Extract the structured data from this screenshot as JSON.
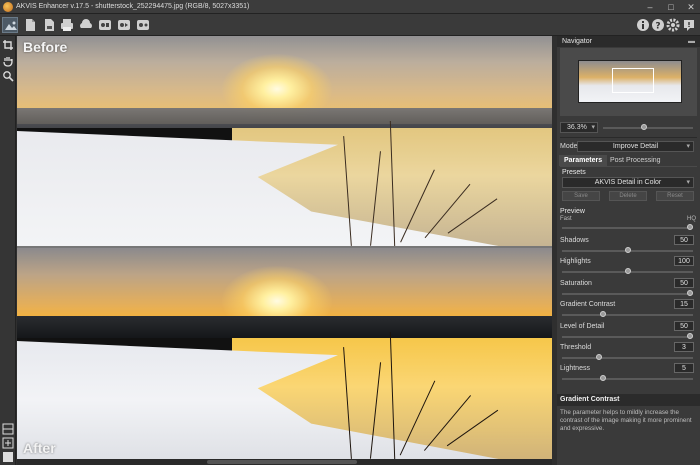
{
  "window": {
    "title": "AKVIS Enhancer v.17.5 - shutterstock_252294475.jpg (RGB/8, 5027x3351)",
    "minimize": "–",
    "maximize": "□",
    "close": "✕"
  },
  "toolbar": {
    "icons": [
      "workspace-icon",
      "open-icon",
      "save-icon",
      "print-icon",
      "share-icon",
      "batch-icon",
      "before-after-icon",
      "preferences-icon"
    ],
    "right_icons": [
      "info-icon",
      "help-icon",
      "settings-icon",
      "notification-icon"
    ]
  },
  "canvas": {
    "before_label": "Before",
    "after_label": "After"
  },
  "navigator": {
    "title": "Navigator",
    "zoom": "36.3%",
    "zoom_level": 0.45
  },
  "mode": {
    "label": "Mode:",
    "value": "Improve Detail"
  },
  "tabs": [
    "Parameters",
    "Post Processing"
  ],
  "presets": {
    "label": "Presets",
    "value": "AKVIS Detail in Color",
    "save": "Save",
    "delete": "Delete",
    "reset": "Reset"
  },
  "preview": {
    "label": "Preview",
    "fast": "Fast",
    "hq": "HQ",
    "level": 1.0
  },
  "params": [
    {
      "name": "Shadows",
      "value": "50",
      "level": 0.5
    },
    {
      "name": "Highlights",
      "value": "100",
      "level": 0.5
    },
    {
      "name": "Saturation",
      "value": "50",
      "level": 1.0
    },
    {
      "name": "Gradient Contrast",
      "value": "15",
      "level": 0.3
    },
    {
      "name": "Level of Detail",
      "value": "50",
      "level": 1.0
    },
    {
      "name": "Threshold",
      "value": "3",
      "level": 0.27
    },
    {
      "name": "Lightness",
      "value": "5",
      "level": 0.3
    }
  ],
  "hint": {
    "title": "Gradient Contrast",
    "text": "The parameter helps to mildly increase the contrast of the image making it more prominent and expressive."
  }
}
